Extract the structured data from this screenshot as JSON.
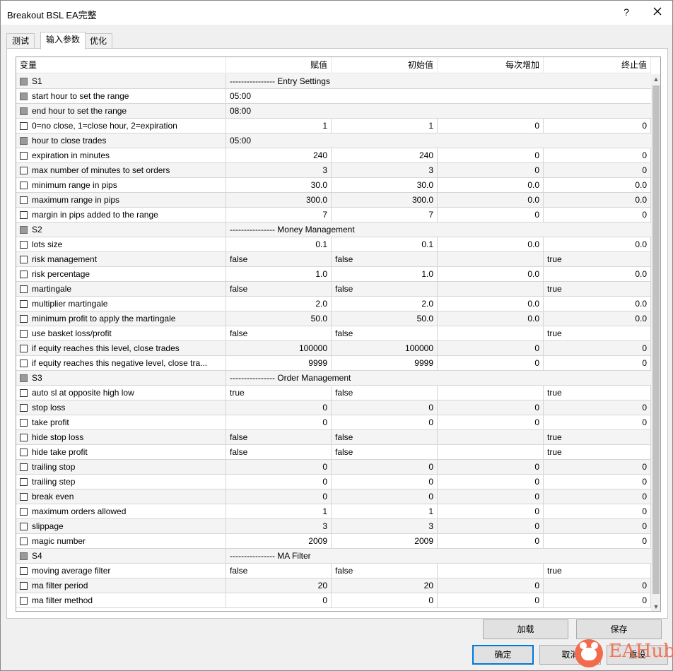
{
  "window": {
    "title": "Breakout BSL EA完整",
    "help_label": "?"
  },
  "tabs": [
    {
      "label": "测试",
      "active": false
    },
    {
      "label": "输入参数",
      "active": true
    },
    {
      "label": "优化",
      "active": false
    }
  ],
  "columns": [
    "变量",
    "赋值",
    "初始值",
    "每次增加",
    "终止值"
  ],
  "rows": [
    {
      "type": "section",
      "name": "S1",
      "value": "---------------- Entry Settings"
    },
    {
      "type": "text",
      "name": "start hour to set the range",
      "value": "05:00"
    },
    {
      "type": "text",
      "name": "end hour to set the range",
      "value": "08:00"
    },
    {
      "type": "num",
      "name": "0=no close, 1=close hour, 2=expiration",
      "value": "1",
      "start": "1",
      "step": "0",
      "stop": "0"
    },
    {
      "type": "text",
      "name": "hour to close trades",
      "value": "05:00"
    },
    {
      "type": "num",
      "name": "expiration in minutes",
      "value": "240",
      "start": "240",
      "step": "0",
      "stop": "0"
    },
    {
      "type": "num",
      "name": "max number of minutes to set orders",
      "value": "3",
      "start": "3",
      "step": "0",
      "stop": "0"
    },
    {
      "type": "num",
      "name": "minimum range in pips",
      "value": "30.0",
      "start": "30.0",
      "step": "0.0",
      "stop": "0.0"
    },
    {
      "type": "num",
      "name": "maximum range in pips",
      "value": "300.0",
      "start": "300.0",
      "step": "0.0",
      "stop": "0.0"
    },
    {
      "type": "num",
      "name": "margin in pips added to the range",
      "value": "7",
      "start": "7",
      "step": "0",
      "stop": "0"
    },
    {
      "type": "section",
      "name": "S2",
      "value": "---------------- Money Management"
    },
    {
      "type": "num",
      "name": "lots size",
      "value": "0.1",
      "start": "0.1",
      "step": "0.0",
      "stop": "0.0"
    },
    {
      "type": "bool",
      "name": "risk management",
      "value": "false",
      "start": "false",
      "step": "",
      "stop": "true"
    },
    {
      "type": "num",
      "name": "risk percentage",
      "value": "1.0",
      "start": "1.0",
      "step": "0.0",
      "stop": "0.0"
    },
    {
      "type": "bool",
      "name": "martingale",
      "value": "false",
      "start": "false",
      "step": "",
      "stop": "true"
    },
    {
      "type": "num",
      "name": "multiplier martingale",
      "value": "2.0",
      "start": "2.0",
      "step": "0.0",
      "stop": "0.0"
    },
    {
      "type": "num",
      "name": "minimum profit to apply the martingale",
      "value": "50.0",
      "start": "50.0",
      "step": "0.0",
      "stop": "0.0"
    },
    {
      "type": "bool",
      "name": "use basket loss/profit",
      "value": "false",
      "start": "false",
      "step": "",
      "stop": "true"
    },
    {
      "type": "num",
      "name": "if equity reaches this level, close trades",
      "value": "100000",
      "start": "100000",
      "step": "0",
      "stop": "0"
    },
    {
      "type": "num",
      "name": "if equity reaches this negative level, close tra...",
      "value": "9999",
      "start": "9999",
      "step": "0",
      "stop": "0"
    },
    {
      "type": "section",
      "name": "S3",
      "value": "---------------- Order Management"
    },
    {
      "type": "bool",
      "name": "auto sl at opposite high low",
      "value": "true",
      "start": "false",
      "step": "",
      "stop": "true"
    },
    {
      "type": "num",
      "name": "stop loss",
      "value": "0",
      "start": "0",
      "step": "0",
      "stop": "0"
    },
    {
      "type": "num",
      "name": "take profit",
      "value": "0",
      "start": "0",
      "step": "0",
      "stop": "0"
    },
    {
      "type": "bool",
      "name": "hide stop loss",
      "value": "false",
      "start": "false",
      "step": "",
      "stop": "true"
    },
    {
      "type": "bool",
      "name": "hide take profit",
      "value": "false",
      "start": "false",
      "step": "",
      "stop": "true"
    },
    {
      "type": "num",
      "name": "trailing stop",
      "value": "0",
      "start": "0",
      "step": "0",
      "stop": "0"
    },
    {
      "type": "num",
      "name": "trailing step",
      "value": "0",
      "start": "0",
      "step": "0",
      "stop": "0"
    },
    {
      "type": "num",
      "name": "break even",
      "value": "0",
      "start": "0",
      "step": "0",
      "stop": "0"
    },
    {
      "type": "num",
      "name": "maximum orders allowed",
      "value": "1",
      "start": "1",
      "step": "0",
      "stop": "0"
    },
    {
      "type": "num",
      "name": "slippage",
      "value": "3",
      "start": "3",
      "step": "0",
      "stop": "0"
    },
    {
      "type": "num",
      "name": "magic number",
      "value": "2009",
      "start": "2009",
      "step": "0",
      "stop": "0"
    },
    {
      "type": "section",
      "name": "S4",
      "value": "---------------- MA Filter"
    },
    {
      "type": "bool",
      "name": "moving average filter",
      "value": "false",
      "start": "false",
      "step": "",
      "stop": "true"
    },
    {
      "type": "num",
      "name": "ma filter period",
      "value": "20",
      "start": "20",
      "step": "0",
      "stop": "0"
    },
    {
      "type": "num",
      "name": "ma filter method",
      "value": "0",
      "start": "0",
      "step": "0",
      "stop": "0"
    }
  ],
  "buttons": {
    "load": "加载",
    "save": "保存",
    "ok": "确定",
    "cancel": "取消",
    "reset": "重设"
  },
  "watermark": {
    "text": "EAHub"
  }
}
